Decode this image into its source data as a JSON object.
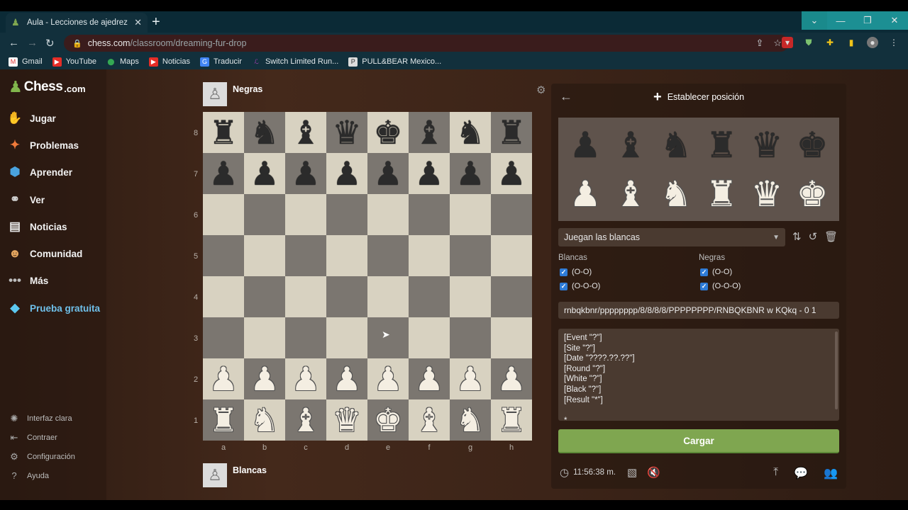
{
  "browser": {
    "tab_title": "Aula - Lecciones de ajedrez para",
    "new_tab_icon": "plus-icon",
    "url_domain": "chess.com",
    "url_path": "/classroom/dreaming-fur-drop",
    "bookmarks": [
      {
        "label": "Gmail",
        "color": "#ffffff"
      },
      {
        "label": "YouTube",
        "color": "#e52d27"
      },
      {
        "label": "Maps",
        "color": "#34a853"
      },
      {
        "label": "Noticias",
        "color": "#e52d27"
      },
      {
        "label": "Traducir",
        "color": "#4285f4"
      },
      {
        "label": "Switch Limited Run...",
        "color": "#a33fb0"
      },
      {
        "label": "PULL&BEAR Mexico...",
        "color": "#dddddd"
      }
    ]
  },
  "sidebar": {
    "logo_text": "Chess",
    "logo_domain": ".com",
    "items": [
      {
        "label": "Jugar",
        "icon": "play-hand-icon"
      },
      {
        "label": "Problemas",
        "icon": "puzzle-icon"
      },
      {
        "label": "Aprender",
        "icon": "learn-cap-icon"
      },
      {
        "label": "Ver",
        "icon": "binoculars-icon"
      },
      {
        "label": "Noticias",
        "icon": "news-icon"
      },
      {
        "label": "Comunidad",
        "icon": "community-icon"
      },
      {
        "label": "Más",
        "icon": "more-dots-icon"
      },
      {
        "label": "Prueba gratuita",
        "icon": "diamond-icon"
      }
    ],
    "bottom_items": [
      {
        "label": "Interfaz clara",
        "icon": "sun-icon"
      },
      {
        "label": "Contraer",
        "icon": "collapse-icon"
      },
      {
        "label": "Configuración",
        "icon": "gear-icon"
      },
      {
        "label": "Ayuda",
        "icon": "help-icon"
      }
    ]
  },
  "board": {
    "top_player": "Negras",
    "bottom_player": "Blancas",
    "ranks": [
      "8",
      "7",
      "6",
      "5",
      "4",
      "3",
      "2",
      "1"
    ],
    "files": [
      "a",
      "b",
      "c",
      "d",
      "e",
      "f",
      "g",
      "h"
    ],
    "position": [
      [
        "r",
        "n",
        "b",
        "q",
        "k",
        "b",
        "n",
        "r"
      ],
      [
        "p",
        "p",
        "p",
        "p",
        "p",
        "p",
        "p",
        "p"
      ],
      [
        "",
        "",
        "",
        "",
        "",
        "",
        "",
        ""
      ],
      [
        "",
        "",
        "",
        "",
        "",
        "",
        "",
        ""
      ],
      [
        "",
        "",
        "",
        "",
        "",
        "",
        "",
        ""
      ],
      [
        "",
        "",
        "",
        "",
        "",
        "",
        "",
        ""
      ],
      [
        "P",
        "P",
        "P",
        "P",
        "P",
        "P",
        "P",
        "P"
      ],
      [
        "R",
        "N",
        "B",
        "Q",
        "K",
        "B",
        "N",
        "R"
      ]
    ]
  },
  "panel": {
    "title": "Establecer posición",
    "turn_select": "Juegan las blancas",
    "white_label": "Blancas",
    "black_label": "Negras",
    "castle_short": "(O-O)",
    "castle_long": "(O-O-O)",
    "fen": "rnbqkbnr/pppppppp/8/8/8/8/PPPPPPPP/RNBQKBNR w KQkq - 0 1",
    "pgn_lines": [
      "[Event \"?\"]",
      "[Site \"?\"]",
      "[Date \"????.??.??\"]",
      "[Round \"?\"]",
      "[White \"?\"]",
      "[Black \"?\"]",
      "[Result \"*\"]",
      "",
      "*"
    ],
    "load_button": "Cargar",
    "clock": "11:56:38 m."
  },
  "colors": {
    "accent_green": "#7fa650",
    "checkbox_blue": "#2e7bd6",
    "board_light": "#d8d2c1",
    "board_dark": "#7b7670"
  }
}
